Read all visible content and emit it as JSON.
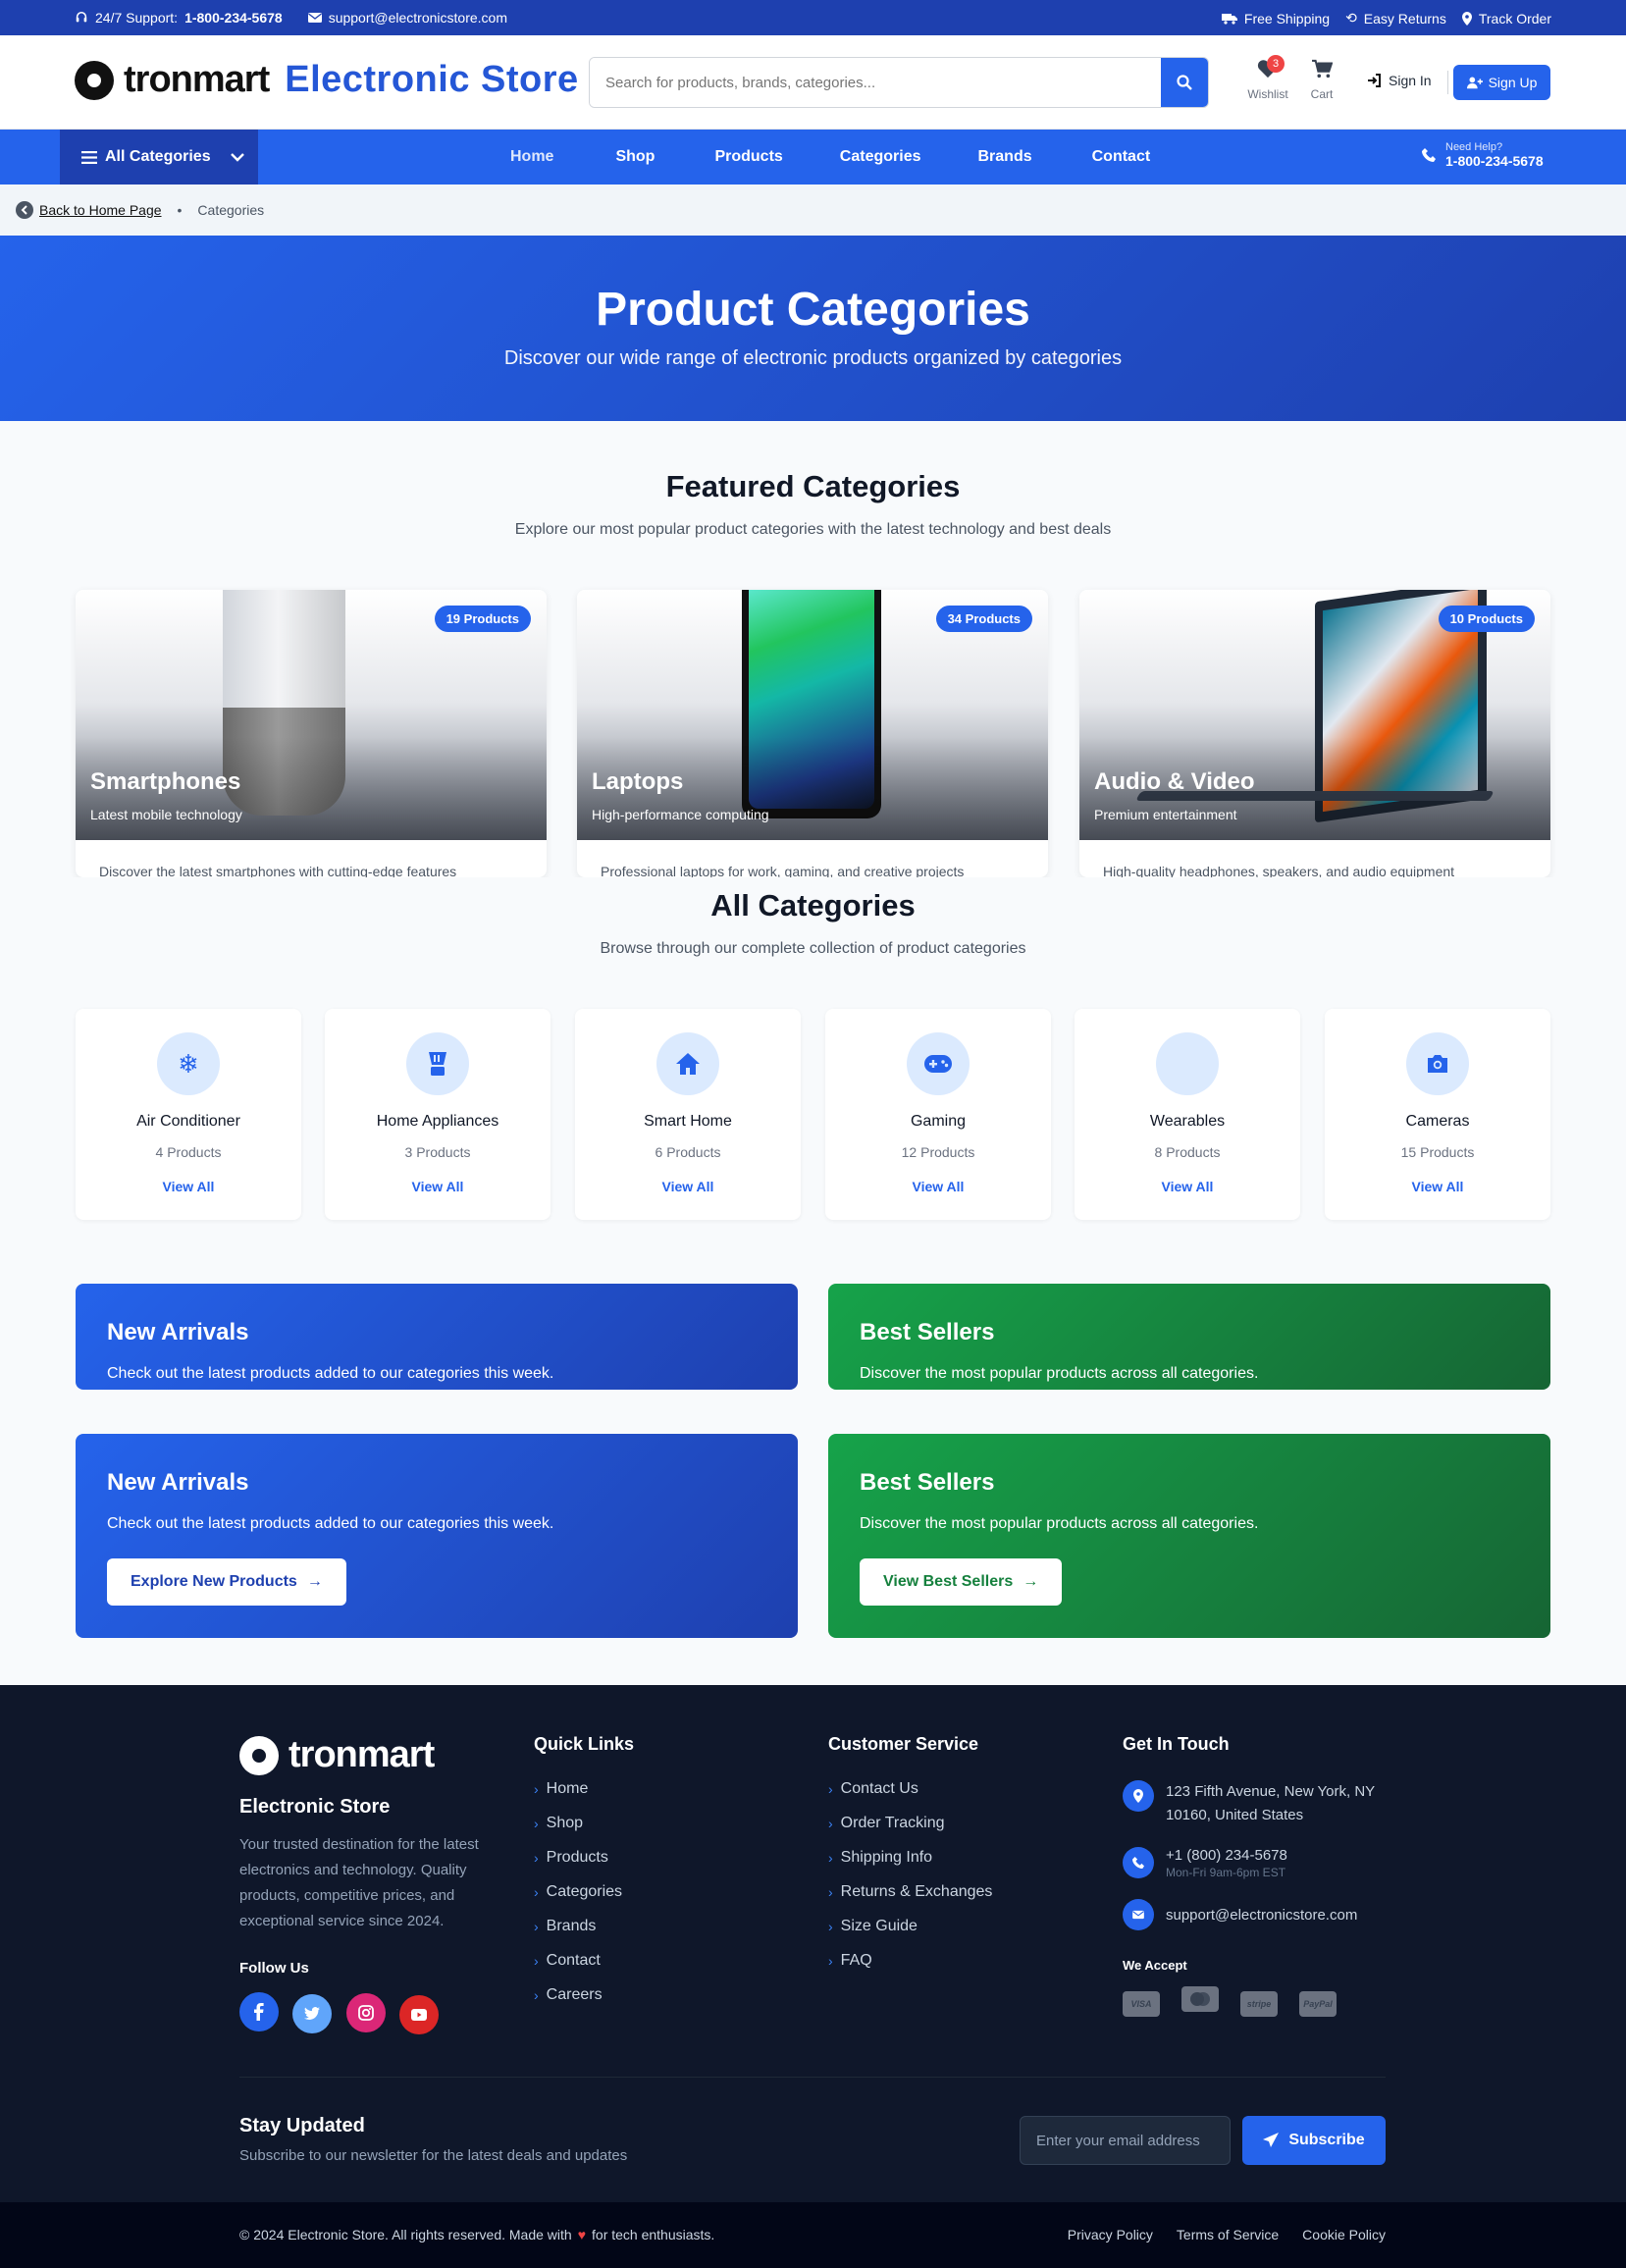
{
  "topbar": {
    "support_label": "24/7 Support:",
    "support_phone": "1-800-234-5678",
    "email": "support@electronicstore.com",
    "shipping": "Free Shipping",
    "returns": "Easy Returns",
    "track": "Track Order"
  },
  "header": {
    "logo_word": "tronmart",
    "store_name": "Electronic Store",
    "search_placeholder": "Search for products, brands, categories...",
    "wishlist_label": "Wishlist",
    "wishlist_count": "3",
    "cart_label": "Cart",
    "signin_label": "Sign In",
    "signup_label": "Sign Up"
  },
  "nav": {
    "all_categories": "All Categories",
    "links": [
      "Home",
      "Shop",
      "Products",
      "Categories",
      "Brands",
      "Contact"
    ],
    "help_label": "Need Help?",
    "help_phone": "1-800-234-5678"
  },
  "breadcrumb": {
    "back": "Back to Home Page",
    "current": "Categories"
  },
  "hero": {
    "title": "Product Categories",
    "subtitle": "Discover our wide range of electronic products organized by categories"
  },
  "featured": {
    "title": "Featured Categories",
    "subtitle": "Explore our most popular product categories with the latest technology and best deals",
    "cards": [
      {
        "name": "Smartphones",
        "tagline": "Latest mobile technology",
        "badge": "19 Products",
        "description": "Discover the latest smartphones with cutting-edge features"
      },
      {
        "name": "Laptops",
        "tagline": "High-performance computing",
        "badge": "34 Products",
        "description": "Professional laptops for work, gaming, and creative projects"
      },
      {
        "name": "Audio & Video",
        "tagline": "Premium entertainment",
        "badge": "10 Products",
        "description": "High-quality headphones, speakers, and audio equipment"
      }
    ]
  },
  "all_categories": {
    "title": "All Categories",
    "subtitle": "Browse through our complete collection of product categories",
    "items": [
      {
        "name": "Air Conditioner",
        "count": "4 Products",
        "link": "View All",
        "icon": "snowflake-icon"
      },
      {
        "name": "Home Appliances",
        "count": "3 Products",
        "link": "View All",
        "icon": "blender-icon"
      },
      {
        "name": "Smart Home",
        "count": "6 Products",
        "link": "View All",
        "icon": "home-icon"
      },
      {
        "name": "Gaming",
        "count": "12 Products",
        "link": "View All",
        "icon": "gamepad-icon"
      },
      {
        "name": "Wearables",
        "count": "8 Products",
        "link": "View All",
        "icon": "watch-icon"
      },
      {
        "name": "Cameras",
        "count": "15 Products",
        "link": "View All",
        "icon": "camera-icon"
      }
    ]
  },
  "promos": {
    "new_arrivals": {
      "title": "New Arrivals",
      "text": "Check out the latest products added to our categories this week.",
      "button": "Explore New Products"
    },
    "best_sellers": {
      "title": "Best Sellers",
      "text": "Discover the most popular products across all categories.",
      "button": "View Best Sellers"
    }
  },
  "footer": {
    "logo_word": "tronmart",
    "store_name": "Electronic Store",
    "about": "Your trusted destination for the latest electronics and technology. Quality products, competitive prices, and exceptional service since 2024.",
    "follow_us": "Follow Us",
    "quick_links_title": "Quick Links",
    "quick_links": [
      "Home",
      "Shop",
      "Products",
      "Categories",
      "Brands",
      "Contact",
      "Careers"
    ],
    "customer_service_title": "Customer Service",
    "customer_service": [
      "Contact Us",
      "Order Tracking",
      "Shipping Info",
      "Returns & Exchanges",
      "Size Guide",
      "FAQ"
    ],
    "get_in_touch_title": "Get In Touch",
    "address": "123 Fifth Avenue, New York, NY 10160, United States",
    "phone": "+1 (800) 234-5678",
    "hours": "Mon-Fri 9am-6pm EST",
    "email": "support@electronicstore.com",
    "we_accept": "We Accept",
    "payment_methods": [
      "VISA",
      "MC",
      "stripe",
      "PayPal"
    ],
    "newsletter_title": "Stay Updated",
    "newsletter_subtitle": "Subscribe to our newsletter for the latest deals and updates",
    "newsletter_placeholder": "Enter your email address",
    "subscribe_label": "Subscribe",
    "copyright_pre": "© 2024 Electronic Store. All rights reserved. Made with",
    "copyright_post": "for tech enthusiasts.",
    "legal_links": [
      "Privacy Policy",
      "Terms of Service",
      "Cookie Policy"
    ]
  },
  "colors": {
    "primary": "#2563eb",
    "primary_dark": "#1e40af",
    "success": "#16a34a",
    "footer_bg": "#0f172a",
    "badge_red": "#ef4444"
  }
}
